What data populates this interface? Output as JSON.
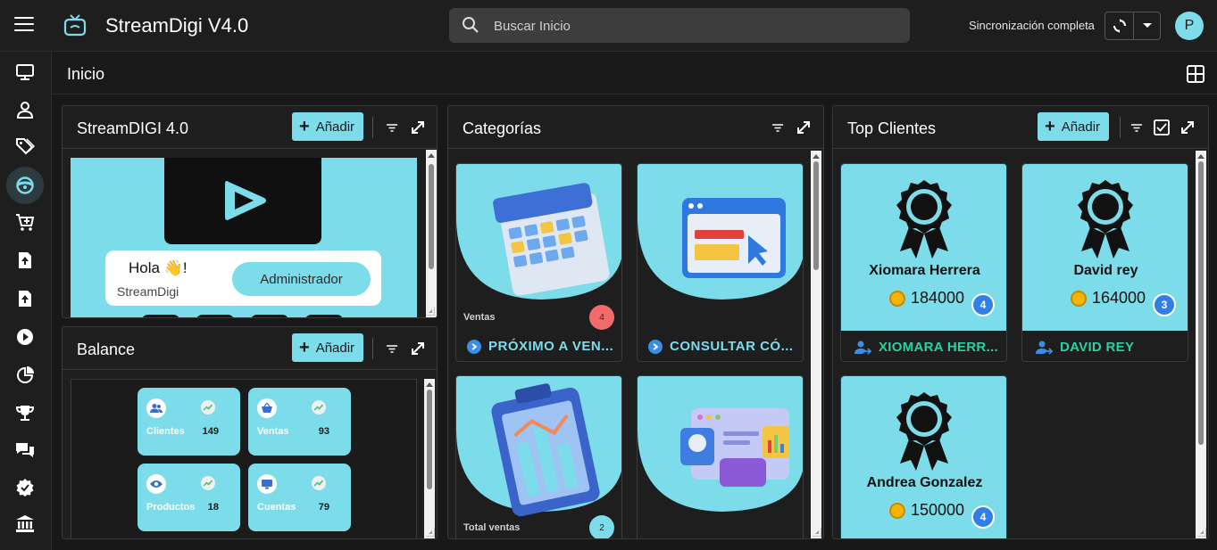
{
  "app": {
    "title": "StreamDigi V4.0",
    "search_placeholder": "Buscar Inicio",
    "sync_status": "Sincronización completa",
    "avatar_initial": "P",
    "accent": "#7cdcea"
  },
  "page": {
    "title": "Inicio"
  },
  "sidebar": {
    "items": [
      "monitor-icon",
      "user-icon",
      "tags-icon",
      "steering-wheel-icon",
      "cart-icon",
      "upload-icon",
      "upload-file-icon",
      "play-icon",
      "pie-chart-icon",
      "trophy-icon",
      "chat-icon",
      "verified-icon",
      "bank-icon"
    ],
    "active_index": 3
  },
  "streamdigi_panel": {
    "title": "StreamDIGI 4.0",
    "add_label": "Añadir",
    "greeting": "Hola 👋!",
    "brand": "StreamDigi",
    "role_button": "Administrador"
  },
  "balance_panel": {
    "title": "Balance",
    "add_label": "Añadir",
    "stats": [
      {
        "label": "Clientes",
        "value": "149",
        "icon": "people-icon"
      },
      {
        "label": "Ventas",
        "value": "93",
        "icon": "basket-icon"
      },
      {
        "label": "Productos",
        "value": "18",
        "icon": "eye-icon"
      },
      {
        "label": "Cuentas",
        "value": "79",
        "icon": "monitor-icon"
      }
    ]
  },
  "categories_panel": {
    "title": "Categorías",
    "cards": [
      {
        "subtitle": "Ventas",
        "badge": "4",
        "badge_color": "#f26b6b",
        "link": "PRÓXIMO A VEN..."
      },
      {
        "subtitle": "",
        "badge": "",
        "badge_color": "",
        "link": "CONSULTAR CÓ..."
      },
      {
        "subtitle": "Total ventas",
        "badge": "2",
        "badge_color": "#7cdcea",
        "link": ""
      },
      {
        "subtitle": "",
        "badge": "",
        "badge_color": "",
        "link": ""
      }
    ]
  },
  "clients_panel": {
    "title": "Top Clientes",
    "add_label": "Añadir",
    "clients": [
      {
        "name": "Xiomara Herrera",
        "amount": "184000",
        "rank": "4",
        "link": "XIOMARA HERR..."
      },
      {
        "name": "David rey",
        "amount": "164000",
        "rank": "3",
        "link": "DAVID REY"
      },
      {
        "name": "Andrea Gonzalez",
        "amount": "150000",
        "rank": "4",
        "link": ""
      }
    ]
  }
}
